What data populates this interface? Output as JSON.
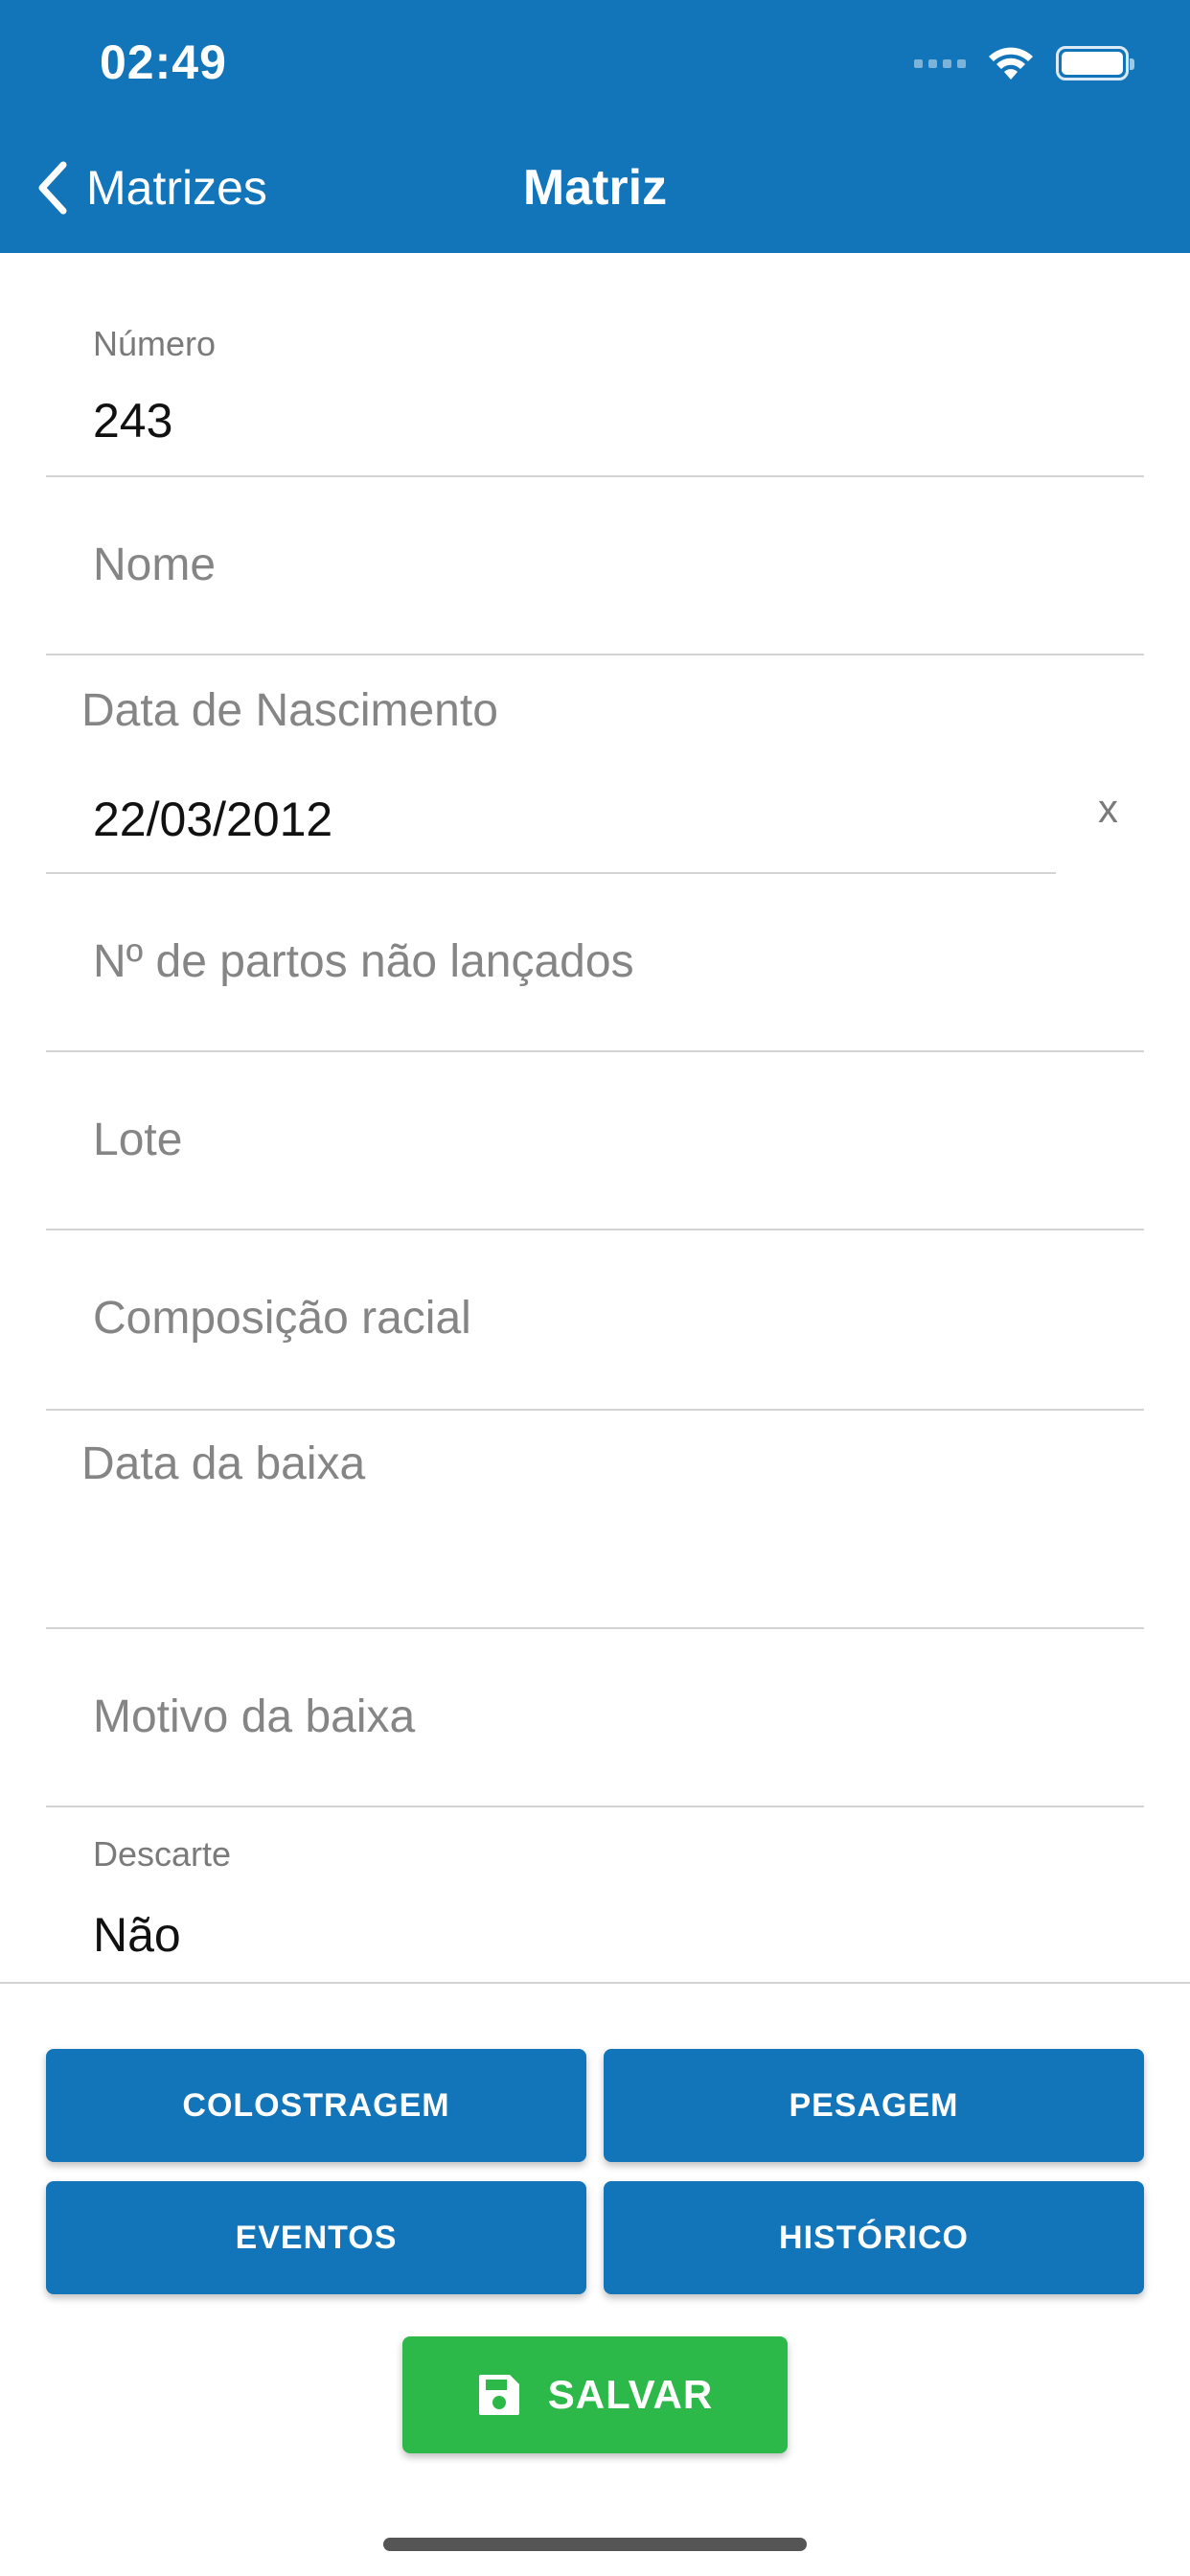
{
  "status_bar": {
    "time": "02:49"
  },
  "nav": {
    "back_label": "Matrizes",
    "title": "Matriz"
  },
  "form": {
    "numero": {
      "label": "Número",
      "value": "243"
    },
    "nome": {
      "placeholder": "Nome"
    },
    "data_nascimento": {
      "label": "Data de Nascimento",
      "value": "22/03/2012",
      "clear": "x"
    },
    "partos": {
      "placeholder": "Nº de partos não lançados"
    },
    "lote": {
      "placeholder": "Lote"
    },
    "composicao": {
      "placeholder": "Composição racial"
    },
    "data_baixa": {
      "label": "Data da baixa"
    },
    "motivo_baixa": {
      "placeholder": "Motivo da baixa"
    },
    "descarte": {
      "label": "Descarte",
      "value": "Não"
    }
  },
  "actions": {
    "colostragem": "COLOSTRAGEM",
    "pesagem": "PESAGEM",
    "eventos": "EVENTOS",
    "historico": "HISTÓRICO",
    "salvar": "SALVAR"
  },
  "colors": {
    "primary": "#1275BA",
    "save": "#2DB84A"
  },
  "icons": {
    "back": "chevron-left-icon",
    "save": "floppy-disk-icon",
    "wifi": "wifi-icon",
    "battery": "battery-icon"
  }
}
